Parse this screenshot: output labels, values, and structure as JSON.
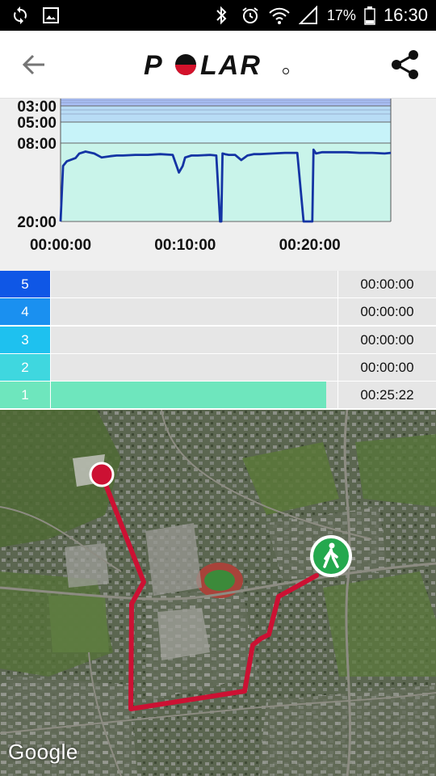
{
  "status_bar": {
    "battery_text": "17%",
    "time": "16:30"
  },
  "app_bar": {
    "logo_text": "POLAR"
  },
  "chart_data": {
    "type": "line",
    "x_ticks": [
      "00:00:00",
      "00:10:00",
      "00:20:00"
    ],
    "y_ticks": [
      "03:00",
      "05:00",
      "08:00",
      "20:00"
    ],
    "zone_colors": [
      "#a9bff5",
      "#b8dcf5",
      "#c7f3f9",
      "#c9f4ea"
    ],
    "line_color": "#1434a4",
    "x_minutes": [
      0,
      0.2,
      0.5,
      1.2,
      1.5,
      2.0,
      2.7,
      3.3,
      4.0,
      4.5,
      5.0,
      6.0,
      7.0,
      8.0,
      9.0,
      9.5,
      9.8,
      10.0,
      10.5,
      11.0,
      12.0,
      12.5,
      12.8,
      12.9,
      13.0,
      13.2,
      13.5,
      14.0,
      14.5,
      15.0,
      15.5,
      16.0,
      17.0,
      18.0,
      19.0,
      19.5,
      19.55,
      20.0,
      20.2,
      20.3,
      20.5,
      21.0,
      22.0,
      23.0,
      24.0,
      25.0,
      26.0,
      26.5
    ],
    "pace_min_per_km": [
      20.0,
      11.5,
      10.8,
      10.3,
      9.6,
      9.3,
      9.6,
      10.2,
      10.0,
      9.9,
      9.9,
      9.8,
      9.8,
      9.7,
      9.8,
      12.5,
      11.5,
      10.2,
      9.9,
      9.9,
      9.8,
      9.9,
      20.0,
      20.0,
      9.6,
      9.7,
      9.8,
      9.8,
      10.6,
      9.9,
      9.7,
      9.7,
      9.6,
      9.5,
      9.5,
      20.0,
      20.0,
      20.0,
      20.0,
      9.0,
      9.6,
      9.4,
      9.4,
      9.4,
      9.5,
      9.5,
      9.6,
      9.5
    ]
  },
  "zones": [
    {
      "label": "5",
      "time": "00:00:00",
      "color": "#0f57e6",
      "fraction": 0
    },
    {
      "label": "4",
      "time": "00:00:00",
      "color": "#1a90f0",
      "fraction": 0
    },
    {
      "label": "3",
      "time": "00:00:00",
      "color": "#1ec1ef",
      "fraction": 0
    },
    {
      "label": "2",
      "time": "00:00:00",
      "color": "#3fd7df",
      "fraction": 0
    },
    {
      "label": "1",
      "time": "00:25:22",
      "color": "#6ee6bd",
      "fraction": 0.96
    }
  ],
  "map": {
    "attribution": "Google",
    "route_color": "#cc1133",
    "start_marker_color": "#cc1133",
    "end_marker_color": "#25a84e",
    "end_marker_icon": "walking-person-icon"
  }
}
